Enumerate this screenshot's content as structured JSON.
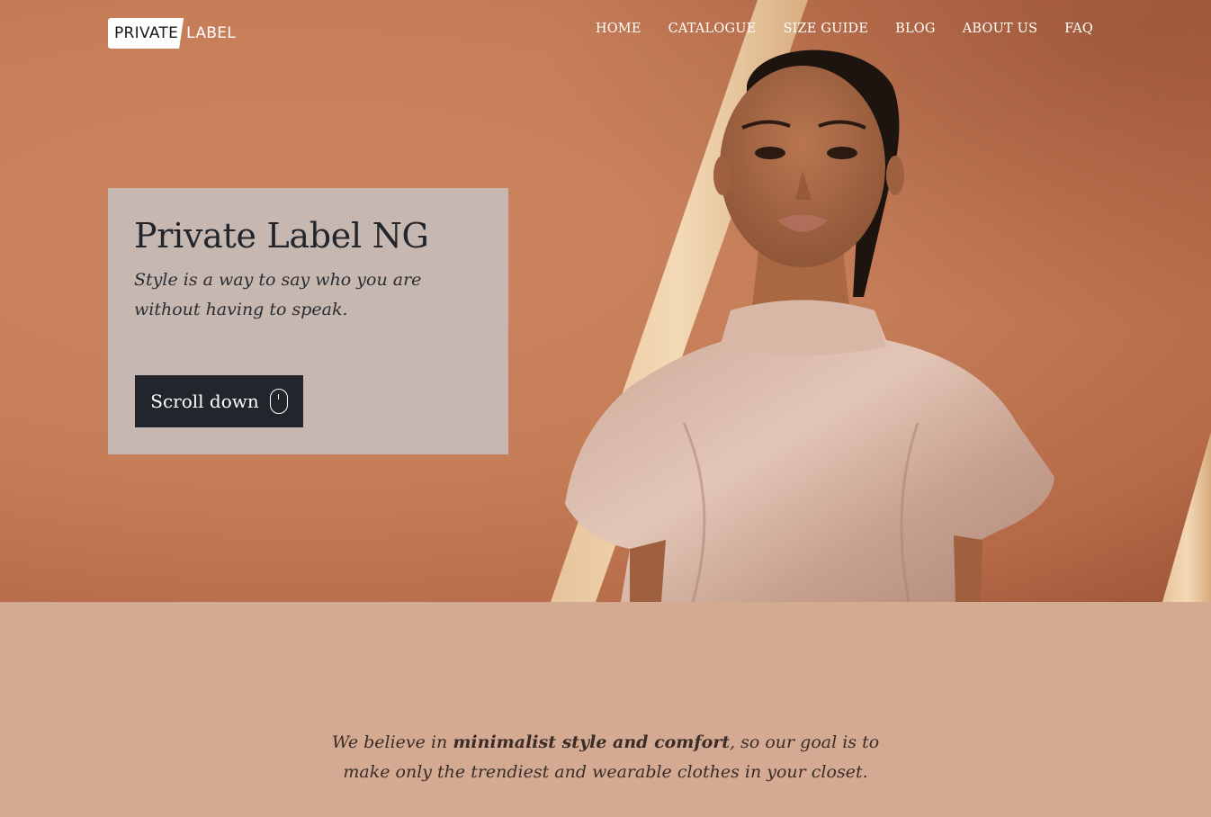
{
  "brand": {
    "logo_part1": "PRIVATE",
    "logo_part2": "LABEL"
  },
  "nav": {
    "items": [
      "HOME",
      "CATALOGUE",
      "SIZE GUIDE",
      "BLOG",
      "ABOUT US",
      "FAQ"
    ]
  },
  "hero": {
    "title": "Private Label NG",
    "subtitle": "Style is a way to say who you are without having to speak.",
    "scroll_button_label": "Scroll down",
    "scroll_button_icon": "mouse-icon"
  },
  "intro": {
    "text_before": "We believe in ",
    "text_emphasis": "minimalist style and comfort",
    "text_after": ", so our goal is to make only the trendiest and wearable clothes in your closet."
  },
  "colors": {
    "hero_background": "#c67e59",
    "card_background": "#c6b7b1",
    "button_background": "#22262c",
    "intro_background": "#d4aa93",
    "heading_text": "#22262c"
  }
}
